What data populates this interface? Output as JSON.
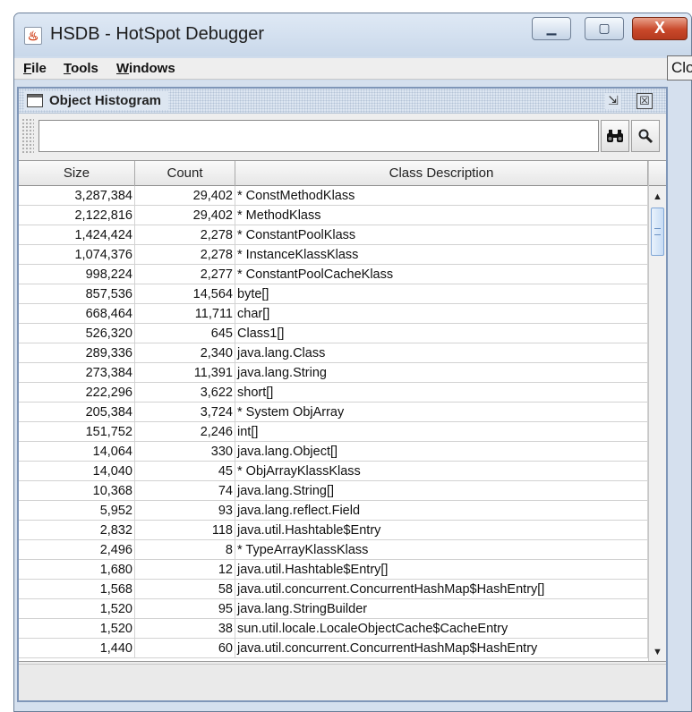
{
  "window": {
    "title": "HSDB - HotSpot Debugger",
    "controls": {
      "minimize": "▁",
      "maximize": "▢",
      "close": "X"
    }
  },
  "menubar": {
    "file": {
      "mnemonic": "F",
      "rest": "ile"
    },
    "tools": {
      "mnemonic": "T",
      "rest": "ools"
    },
    "windows": {
      "mnemonic": "W",
      "rest": "indows"
    },
    "stray_tab": "Clo"
  },
  "frame": {
    "title": "Object Histogram",
    "restore_glyph": "⇲",
    "close_glyph": "☒"
  },
  "toolbar": {
    "search_value": "",
    "find_icon": "binoculars-icon",
    "inspect_icon": "magnifier-icon"
  },
  "table": {
    "columns": [
      "Size",
      "Count",
      "Class Description"
    ],
    "rows": [
      [
        "3,287,384",
        "29,402",
        "* ConstMethodKlass"
      ],
      [
        "2,122,816",
        "29,402",
        "* MethodKlass"
      ],
      [
        "1,424,424",
        "2,278",
        "* ConstantPoolKlass"
      ],
      [
        "1,074,376",
        "2,278",
        "* InstanceKlassKlass"
      ],
      [
        "998,224",
        "2,277",
        "* ConstantPoolCacheKlass"
      ],
      [
        "857,536",
        "14,564",
        "byte[]"
      ],
      [
        "668,464",
        "11,711",
        "char[]"
      ],
      [
        "526,320",
        "645",
        "Class1[]"
      ],
      [
        "289,336",
        "2,340",
        "java.lang.Class"
      ],
      [
        "273,384",
        "11,391",
        "java.lang.String"
      ],
      [
        "222,296",
        "3,622",
        "short[]"
      ],
      [
        "205,384",
        "3,724",
        "* System ObjArray"
      ],
      [
        "151,752",
        "2,246",
        "int[]"
      ],
      [
        "14,064",
        "330",
        "java.lang.Object[]"
      ],
      [
        "14,040",
        "45",
        "* ObjArrayKlassKlass"
      ],
      [
        "10,368",
        "74",
        "java.lang.String[]"
      ],
      [
        "5,952",
        "93",
        "java.lang.reflect.Field"
      ],
      [
        "2,832",
        "118",
        "java.util.Hashtable$Entry"
      ],
      [
        "2,496",
        "8",
        "* TypeArrayKlassKlass"
      ],
      [
        "1,680",
        "12",
        "java.util.Hashtable$Entry[]"
      ],
      [
        "1,568",
        "58",
        "java.util.concurrent.ConcurrentHashMap$HashEntry[]"
      ],
      [
        "1,520",
        "95",
        "java.lang.StringBuilder"
      ],
      [
        "1,520",
        "38",
        "sun.util.locale.LocaleObjectCache$CacheEntry"
      ],
      [
        "1,440",
        "60",
        "java.util.concurrent.ConcurrentHashMap$HashEntry"
      ]
    ]
  },
  "scrollbar": {
    "up_glyph": "▲",
    "down_glyph": "▼",
    "position": 0.0
  },
  "colors": {
    "close_button": "#c9482a",
    "frame_border": "#7f96b8",
    "desktop": "#d5e0ee"
  }
}
